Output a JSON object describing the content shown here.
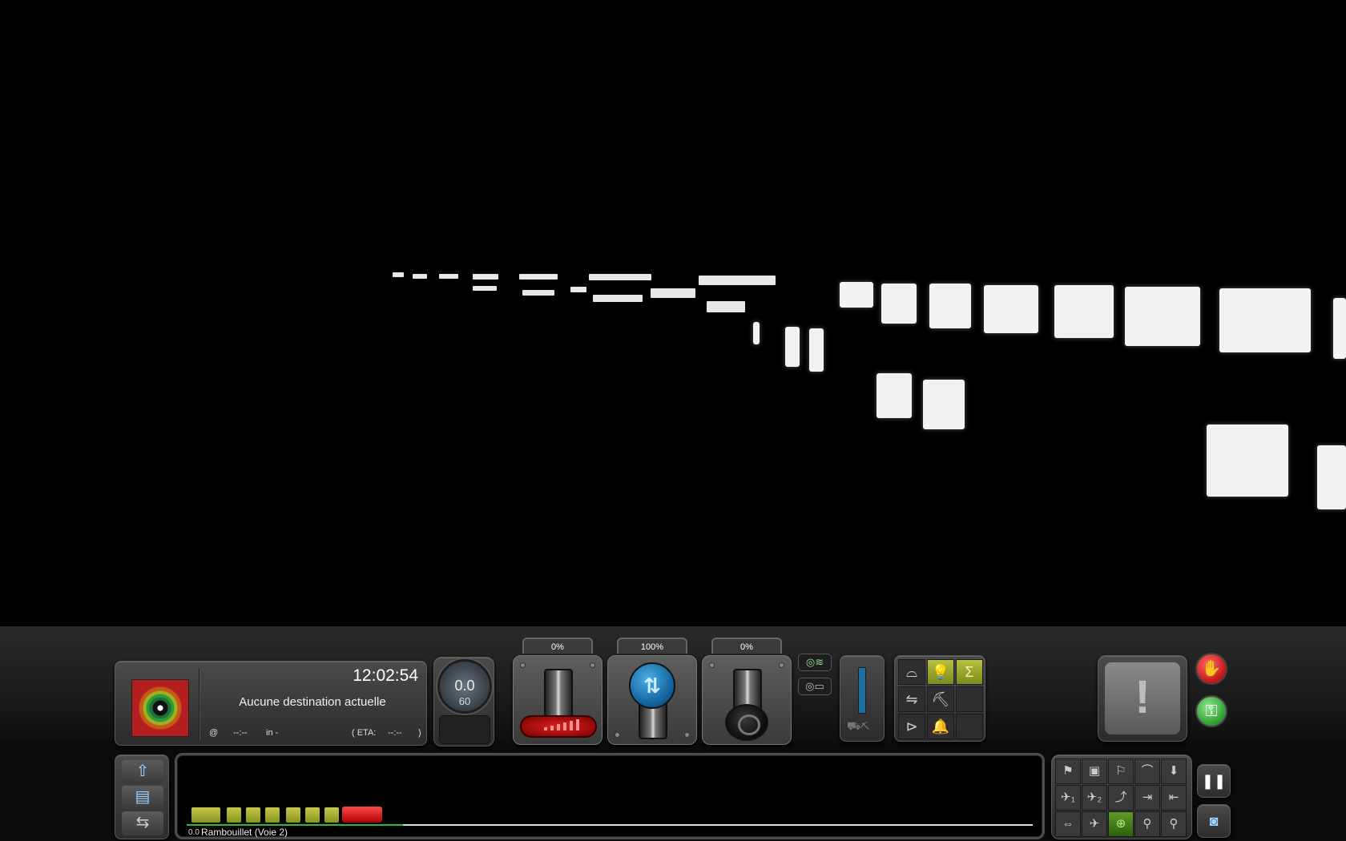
{
  "colors": {
    "throttle_red": "#e02020",
    "reverser_blue": "#0d5d97",
    "function_active": "#b7c040",
    "stop_red": "#c21515",
    "go_green": "#2e9a2e",
    "route_progress": "#1fbf2f"
  },
  "driver": {
    "clock": "12:02:54",
    "destination": "Aucune destination actuelle",
    "at_label": "@",
    "at_time": "--:--",
    "in_label": "in -",
    "eta_label": "( ETA:",
    "eta_time": "--:--",
    "eta_close": ")",
    "signal_icon": "target-signal-icon"
  },
  "speedometer": {
    "speed": "0.0",
    "limit": "60"
  },
  "controls": {
    "throttle": {
      "label": "0%",
      "value": 0,
      "icon": "throttle-lever-icon"
    },
    "reverser": {
      "label": "100%",
      "value": 100,
      "icon": "reverser-arrows-icon",
      "glyph": "⇅"
    },
    "brake": {
      "label": "0%",
      "value": 0,
      "icon": "brake-lever-icon"
    }
  },
  "side_buttons": {
    "camera_loco": "◎≋",
    "camera_view": "◎▭"
  },
  "gauge": {
    "icons": "⛟⛏"
  },
  "functions": [
    {
      "name": "wiper-icon",
      "glyph": "⌓",
      "on": false
    },
    {
      "name": "headlight-icon",
      "glyph": "💡",
      "on": true
    },
    {
      "name": "pantograph-icon",
      "glyph": "Σ",
      "on": true
    },
    {
      "name": "coupler-icon",
      "glyph": "⇋",
      "on": false
    },
    {
      "name": "sander-icon",
      "glyph": "⛏",
      "on": false
    },
    {
      "name": "empty-slot",
      "glyph": "",
      "on": false
    },
    {
      "name": "horn-icon",
      "glyph": "⊳",
      "on": false
    },
    {
      "name": "bell-icon",
      "glyph": "🔔",
      "on": false
    },
    {
      "name": "empty-slot",
      "glyph": "",
      "on": false
    }
  ],
  "alert": {
    "glyph": "!"
  },
  "buttons": {
    "stop_glyph": "✋",
    "start_glyph": "⚿",
    "pause_glyph": "❚❚",
    "photo_glyph": "◙"
  },
  "left_tools": [
    {
      "name": "upload-icon",
      "glyph": "⇧"
    },
    {
      "name": "save-icon",
      "glyph": "▤"
    },
    {
      "name": "switch-icon",
      "glyph": "⇆"
    }
  ],
  "route": {
    "start_km": "0.0",
    "station": "Rambouillet (Voie 2)"
  },
  "cameras": [
    {
      "name": "cam-cab-icon",
      "glyph": "⚑",
      "active": false
    },
    {
      "name": "cam-train-icon",
      "glyph": "▣",
      "active": false
    },
    {
      "name": "cam-side-icon",
      "glyph": "⚐",
      "active": false
    },
    {
      "name": "cam-roof-icon",
      "glyph": "⌒",
      "active": false
    },
    {
      "name": "cam-down-icon",
      "glyph": "⬇",
      "active": false
    },
    {
      "name": "cam-heli1-icon",
      "glyph": "✈₁",
      "active": false
    },
    {
      "name": "cam-heli2-icon",
      "glyph": "✈₂",
      "active": false
    },
    {
      "name": "cam-track-icon",
      "glyph": "⤴",
      "active": false
    },
    {
      "name": "cam-next-icon",
      "glyph": "⇥",
      "active": false
    },
    {
      "name": "cam-prev-icon",
      "glyph": "⇤",
      "active": false
    },
    {
      "name": "cam-orbit-icon",
      "glyph": "⇔",
      "active": false
    },
    {
      "name": "cam-plane-icon",
      "glyph": "✈",
      "active": false
    },
    {
      "name": "cam-globe-icon",
      "glyph": "⊕",
      "active": true
    },
    {
      "name": "cam-pin-icon",
      "glyph": "⚲",
      "active": false
    },
    {
      "name": "cam-marker-icon",
      "glyph": "⚲",
      "active": false
    }
  ]
}
